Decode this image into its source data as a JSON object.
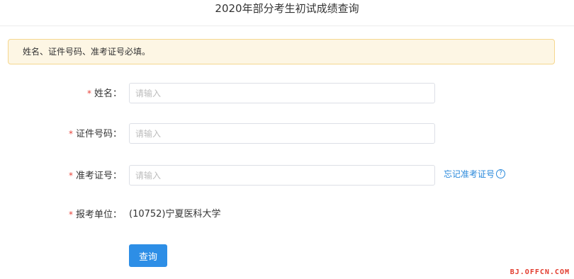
{
  "page": {
    "title": "2020年部分考生初试成绩查询"
  },
  "notice": {
    "text": "姓名、证件号码、准考证号必填。"
  },
  "form": {
    "required_mark": "*",
    "name": {
      "label": "姓名：",
      "placeholder": "请输入",
      "value": ""
    },
    "id_number": {
      "label": "证件号码：",
      "placeholder": "请输入",
      "value": ""
    },
    "exam_number": {
      "label": "准考证号：",
      "placeholder": "请输入",
      "value": "",
      "forgot_link": "忘记准考证号",
      "help_icon_glyph": "?"
    },
    "unit": {
      "label": "报考单位：",
      "value": "(10752)宁夏医科大学"
    },
    "submit_label": "查询"
  },
  "watermark": {
    "text": "BJ.OFFCN.COM"
  },
  "colors": {
    "accent": "#2d8ee6",
    "link": "#2a89db",
    "required": "#e8443a",
    "notice_bg": "#fdf6e4",
    "notice_border": "#f5d78e",
    "watermark": "#e23a2c"
  }
}
